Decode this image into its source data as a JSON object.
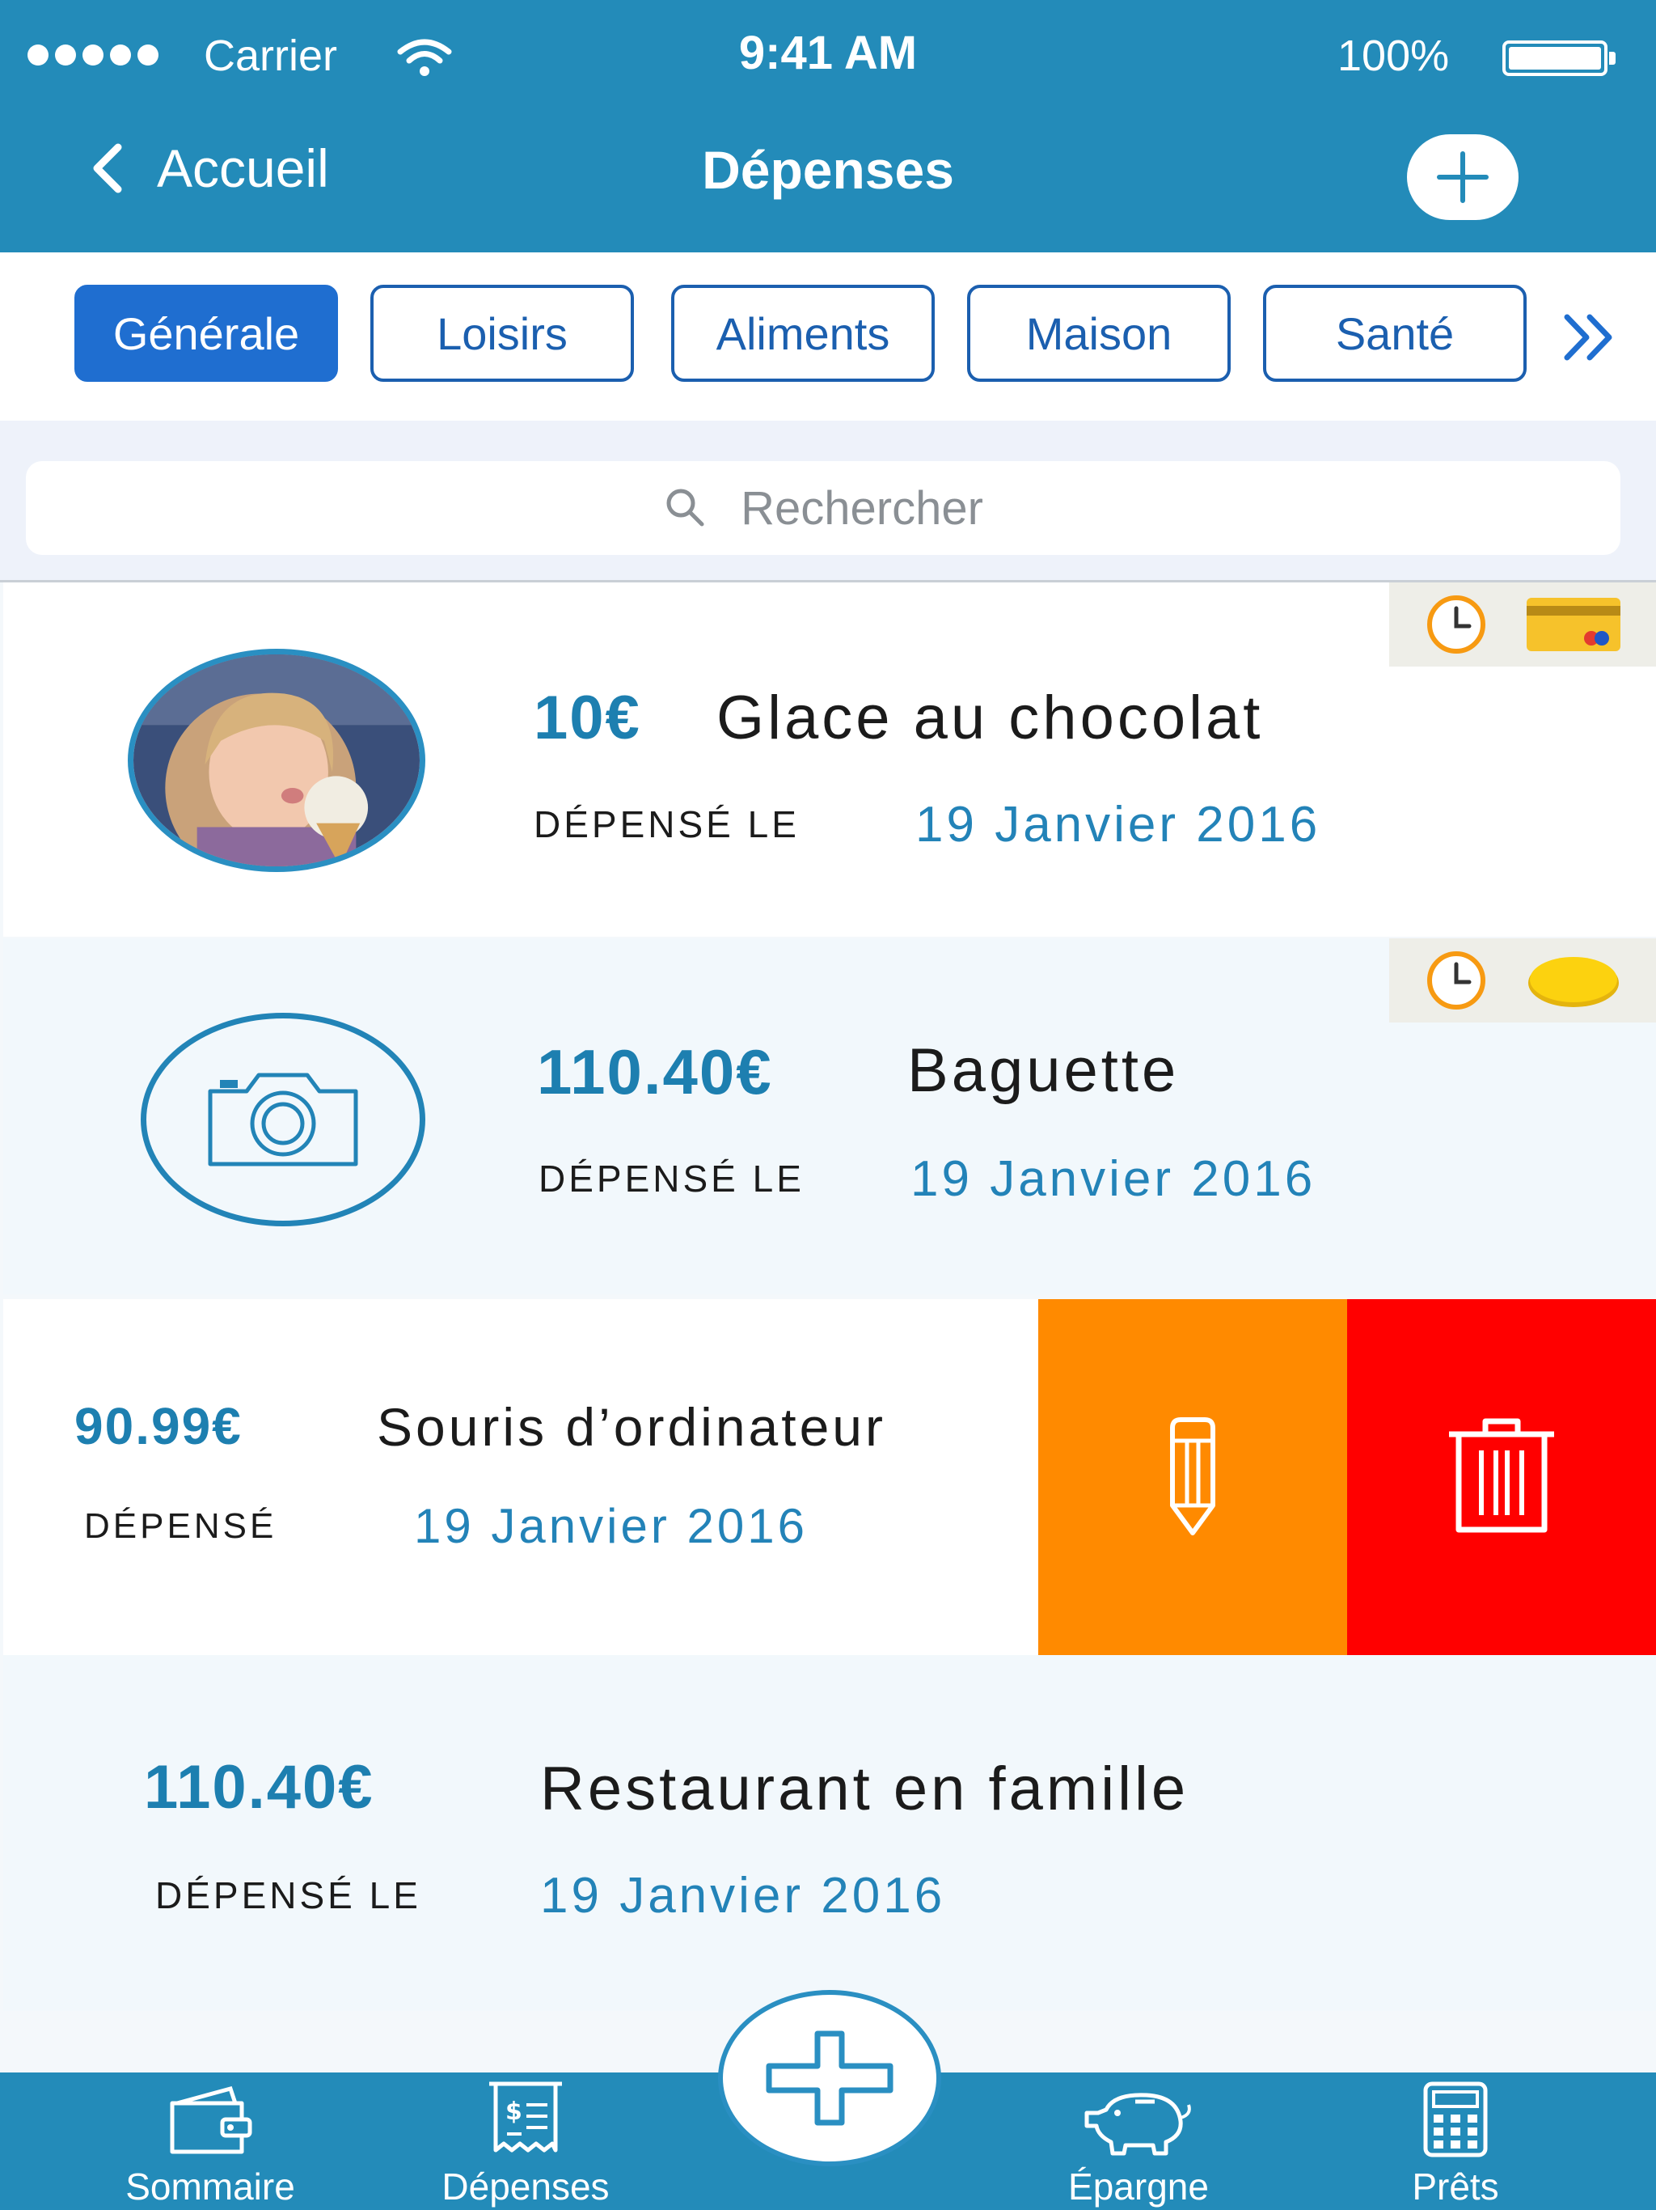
{
  "status_bar": {
    "carrier": "Carrier",
    "time": "9:41 AM",
    "battery": "100%"
  },
  "nav": {
    "back_label": "Accueil",
    "title": "Dépenses"
  },
  "categories": [
    "Générale",
    "Loisirs",
    "Aliments",
    "Maison",
    "Santé"
  ],
  "search": {
    "placeholder": "Rechercher"
  },
  "expenses": [
    {
      "amount": "10€",
      "label": "Glace au chocolat",
      "spent_label": "DÉPENSÉ LE",
      "date": "19 Janvier 2016"
    },
    {
      "amount": "110.40€",
      "label": "Baguette",
      "spent_label": "DÉPENSÉ LE",
      "date": "19 Janvier 2016"
    },
    {
      "amount": "90.99€",
      "label": "Souris d’ordinateur",
      "spent_label": "DÉPENSÉ",
      "date": "19 Janvier 2016"
    },
    {
      "amount": "110.40€",
      "label": "Restaurant en famille",
      "spent_label": "DÉPENSÉ LE",
      "date": "19 Janvier 2016"
    }
  ],
  "tabs": [
    "Sommaire",
    "Dépenses",
    "Épargne",
    "Prêts"
  ],
  "colors": {
    "header": "#238bb9",
    "accent": "#1f6ed0",
    "amount": "#1d7fb0",
    "edit": "#ff8a00",
    "delete": "#ff0000"
  },
  "icons": [
    "back-chevron-icon",
    "plus-icon",
    "double-chevron-right-icon",
    "search-icon",
    "clock-icon",
    "credit-card-icon",
    "coins-icon",
    "camera-icon",
    "pencil-icon",
    "trash-icon",
    "wallet-icon",
    "receipt-icon",
    "piggy-bank-icon",
    "calculator-icon"
  ]
}
